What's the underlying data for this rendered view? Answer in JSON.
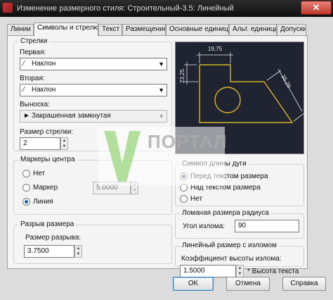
{
  "window": {
    "title": "Изменение размерного стиля: Строительный-3.5: Линейный",
    "close_label": "✕"
  },
  "tabs": [
    {
      "label": "Линии"
    },
    {
      "label": "Символы и стрелки",
      "active": true
    },
    {
      "label": "Текст"
    },
    {
      "label": "Размещение"
    },
    {
      "label": "Основные единицы"
    },
    {
      "label": "Альт. единицы"
    },
    {
      "label": "Допуски"
    }
  ],
  "arrows": {
    "title": "Стрелки",
    "first_label": "Первая:",
    "first_value": "Наклон",
    "second_label": "Вторая:",
    "second_value": "Наклон",
    "leader_label": "Выноска:",
    "leader_value": "Закрашенная замкнутая",
    "size_label": "Размер стрелки:",
    "size_value": "2"
  },
  "center_marks": {
    "title": "Маркеры центра",
    "options": [
      {
        "label": "Нет",
        "checked": false
      },
      {
        "label": "Маркер",
        "checked": false
      },
      {
        "label": "Линия",
        "checked": true
      }
    ],
    "size_value": "5.0000"
  },
  "dim_break": {
    "title": "Разрыв размера",
    "size_label": "Размер разрыва:",
    "size_value": "3.7500"
  },
  "preview": {
    "dim_top": "19,75",
    "dim_left": "23,25",
    "dim_diag": "35,29"
  },
  "arc_length": {
    "title": "Символ длины дуги",
    "options": [
      {
        "label": "Перед текстом размера",
        "checked": true
      },
      {
        "label": "Над текстом размера",
        "checked": false
      },
      {
        "label": "Нет",
        "checked": false
      }
    ]
  },
  "radius_jog": {
    "title": "Ломаная размера радиуса",
    "angle_label": "Угол излома:",
    "angle_value": "90"
  },
  "linear_jog": {
    "title": "Линейный размер с изломом",
    "factor_label": "Коэффициент высоты излома:",
    "factor_value": "1.5000",
    "factor_suffix": "* Высота текста"
  },
  "watermark": {
    "text": "ПОРТАЛ"
  },
  "buttons": {
    "ok": "OK",
    "cancel": "Отмена",
    "help": "Справка"
  },
  "colors": {
    "preview_bg": "#1f2430",
    "preview_lines": "#d4b52c",
    "preview_dims": "#e8e8e8",
    "radio_accent": "#1c5fa8"
  }
}
